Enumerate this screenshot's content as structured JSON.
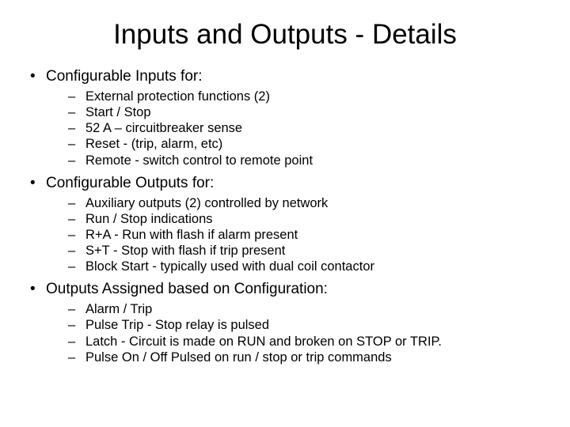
{
  "title": "Inputs and Outputs - Details",
  "sections": [
    {
      "heading": "Configurable Inputs for:",
      "items": [
        "External protection functions (2)",
        "Start / Stop",
        "52 A – circuitbreaker sense",
        "Reset - (trip, alarm, etc)",
        "Remote - switch control to remote point"
      ]
    },
    {
      "heading": "Configurable Outputs for:",
      "items": [
        "Auxiliary outputs (2) controlled by network",
        "Run / Stop indications",
        "R+A - Run with flash if alarm present",
        "S+T - Stop with flash if trip present",
        "Block Start - typically used with dual coil contactor"
      ]
    },
    {
      "heading": "Outputs Assigned based on Configuration:",
      "items": [
        "Alarm / Trip",
        "Pulse Trip - Stop relay is pulsed",
        "Latch - Circuit is made on RUN and broken on STOP or TRIP.",
        "Pulse On / Off Pulsed on run / stop or trip commands"
      ]
    }
  ],
  "bullet_l1": "•",
  "bullet_l2": "–"
}
